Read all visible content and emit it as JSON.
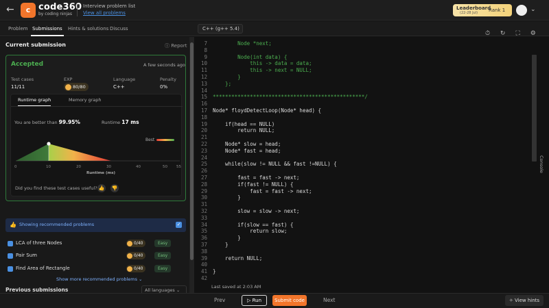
{
  "header": {
    "back_icon": "←",
    "logo_text": "c",
    "brand": "code360",
    "brand_sub": "by coding ninjas",
    "crumb_title": "Interview problem list",
    "crumb_link": "View all problems",
    "leaderboard_label": "Leaderboard",
    "leaderboard_dates": "(22-28 Jul)",
    "rank_label": "Rank",
    "rank_value": "1",
    "chevron_icon": "⌄"
  },
  "tabs": [
    "Problem",
    "Submissions",
    "Hints & solutions",
    "Discuss"
  ],
  "language_select": "C++ (g++ 5.4)",
  "toolbar_icons": [
    "timer-icon",
    "refresh-icon",
    "fullscreen-icon",
    "gear-icon",
    "expand-icon"
  ],
  "submission": {
    "heading": "Current submission",
    "report": "Report",
    "status": "Accepted",
    "time_ago": "A few seconds ago",
    "labels": {
      "test_cases": "Test cases",
      "exp": "EXP",
      "language": "Language",
      "penalty": "Penalty"
    },
    "values": {
      "test_cases": "11/11",
      "exp": "80/80",
      "language": "C++",
      "penalty": "0%"
    },
    "graph_tabs": [
      "Runtime graph",
      "Memory graph"
    ],
    "better_than_label": "You are better than",
    "better_than_value": "99.95%",
    "runtime_label": "Runtime",
    "runtime_value": "17 ms",
    "best_label": "Best",
    "x_ticks": [
      "0",
      "10",
      "20",
      "30",
      "40",
      "50",
      "55"
    ],
    "x_axis_label": "Runtime (ms)",
    "feedback_question": "Did you find these test cases useful?"
  },
  "recommended": {
    "header": "Showing recommended problems",
    "problems": [
      {
        "name": "LCA of three Nodes",
        "coins": "0/40",
        "difficulty": "Easy"
      },
      {
        "name": "Pair Sum",
        "coins": "0/40",
        "difficulty": "Easy"
      },
      {
        "name": "Find Area of Rectangle",
        "coins": "0/40",
        "difficulty": "Easy"
      }
    ],
    "show_more": "Show more recommended problems",
    "previous_submissions": "Previous submissions",
    "all_languages": "All languages"
  },
  "code_lines": [
    {
      "n": "7",
      "t": "        Node *next;",
      "c": true
    },
    {
      "n": "8",
      "t": "",
      "c": true
    },
    {
      "n": "9",
      "t": "        Node(int data) {",
      "c": true
    },
    {
      "n": "10",
      "t": "            this -> data = data;",
      "c": true
    },
    {
      "n": "11",
      "t": "            this -> next = NULL;",
      "c": true
    },
    {
      "n": "12",
      "t": "        }",
      "c": true
    },
    {
      "n": "13",
      "t": "    };",
      "c": true
    },
    {
      "n": "14",
      "t": "",
      "c": false
    },
    {
      "n": "15",
      "t": "*************************************************/",
      "c": true
    },
    {
      "n": "16",
      "t": "",
      "c": false
    },
    {
      "n": "17",
      "t": "Node* floydDetectLoop(Node* head) {",
      "c": false
    },
    {
      "n": "18",
      "t": "",
      "c": false
    },
    {
      "n": "19",
      "t": "    if(head == NULL)",
      "c": false
    },
    {
      "n": "20",
      "t": "        return NULL;",
      "c": false
    },
    {
      "n": "21",
      "t": "",
      "c": false
    },
    {
      "n": "22",
      "t": "    Node* slow = head;",
      "c": false
    },
    {
      "n": "23",
      "t": "    Node* fast = head;",
      "c": false
    },
    {
      "n": "24",
      "t": "",
      "c": false
    },
    {
      "n": "25",
      "t": "    while(slow != NULL && fast !=NULL) {",
      "c": false
    },
    {
      "n": "26",
      "t": "",
      "c": false
    },
    {
      "n": "27",
      "t": "        fast = fast -> next;",
      "c": false
    },
    {
      "n": "28",
      "t": "        if(fast != NULL) {",
      "c": false
    },
    {
      "n": "29",
      "t": "            fast = fast -> next;",
      "c": false
    },
    {
      "n": "30",
      "t": "        }",
      "c": false
    },
    {
      "n": "31",
      "t": "",
      "c": false
    },
    {
      "n": "32",
      "t": "        slow = slow -> next;",
      "c": false
    },
    {
      "n": "33",
      "t": "",
      "c": false
    },
    {
      "n": "34",
      "t": "        if(slow == fast) {",
      "c": false
    },
    {
      "n": "35",
      "t": "            return slow;",
      "c": false
    },
    {
      "n": "36",
      "t": "        }",
      "c": false
    },
    {
      "n": "37",
      "t": "    }",
      "c": false
    },
    {
      "n": "38",
      "t": "",
      "c": false
    },
    {
      "n": "39",
      "t": "    return NULL;",
      "c": false
    },
    {
      "n": "40",
      "t": "",
      "c": false
    },
    {
      "n": "41",
      "t": "}",
      "c": false
    },
    {
      "n": "42",
      "t": "",
      "c": false
    }
  ],
  "editor": {
    "last_saved": "Last saved at 2:03 AM",
    "console": "Console"
  },
  "bottom": {
    "prev": "Prev",
    "run": "Run",
    "submit": "Submit code",
    "next": "Next",
    "hints": "View hints"
  },
  "colors": {
    "accent": "#f2752b",
    "accepted": "#4caf50",
    "link": "#4a90e2"
  }
}
